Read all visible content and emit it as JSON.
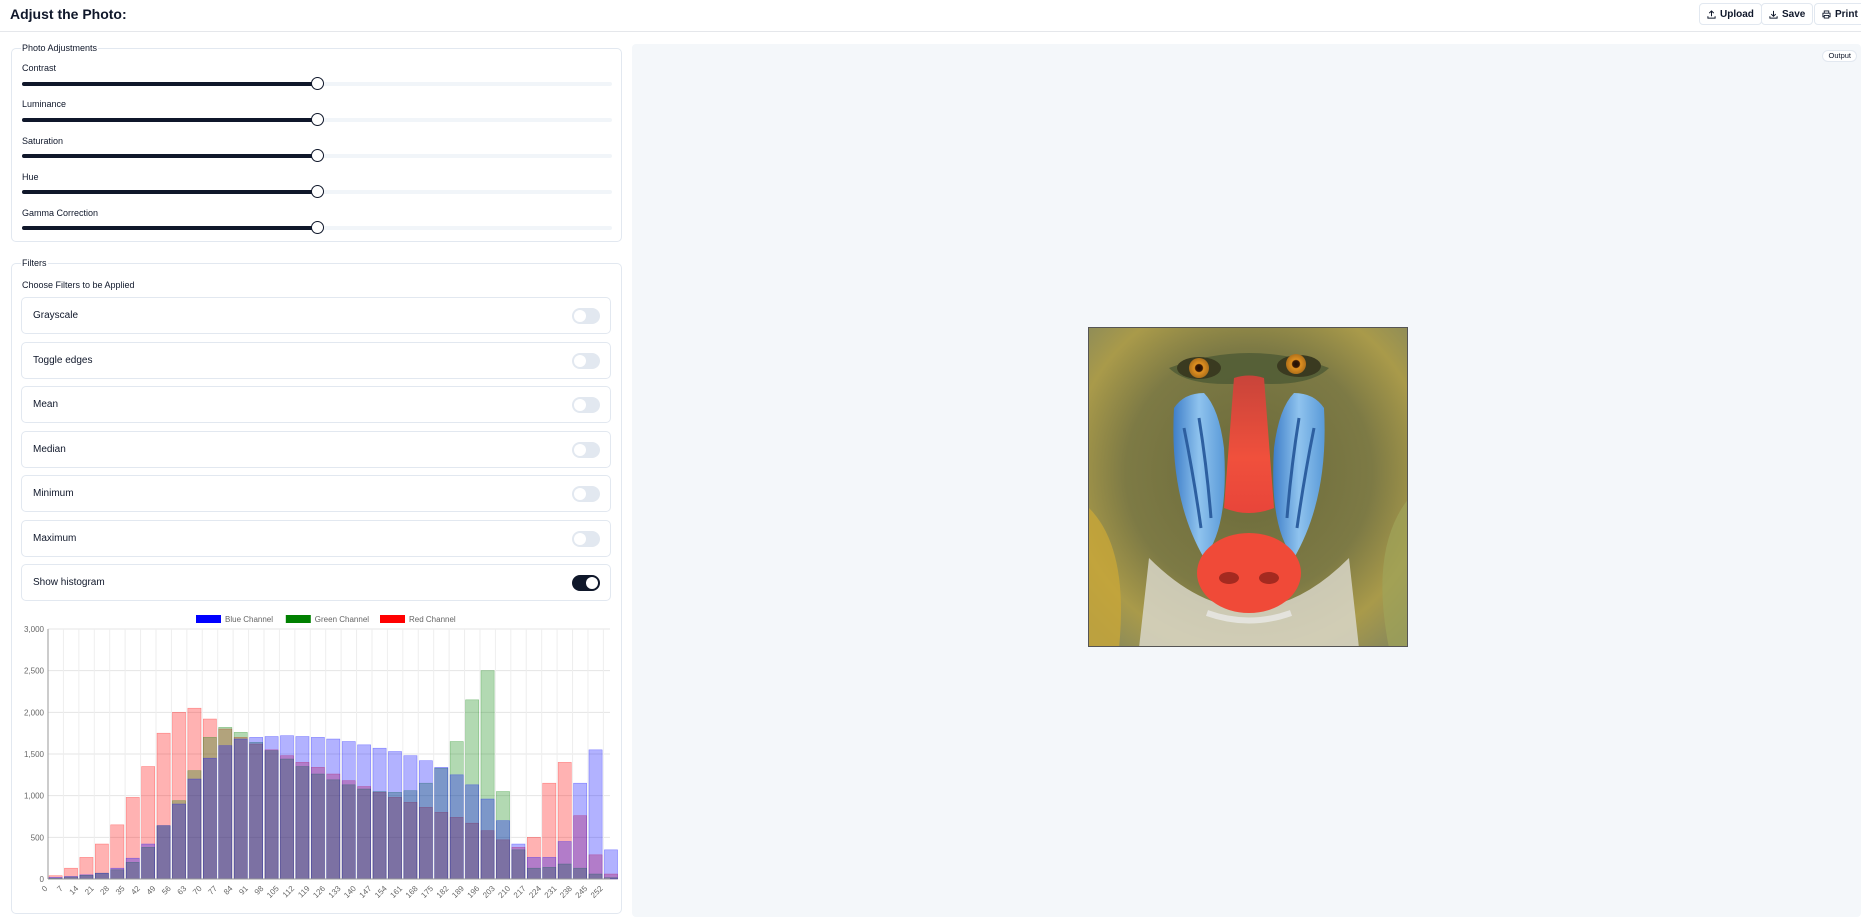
{
  "header": {
    "title": "Adjust the Photo:",
    "buttons": [
      {
        "label": "Upload",
        "icon": "upload-icon"
      },
      {
        "label": "Save",
        "icon": "download-icon"
      },
      {
        "label": "Print",
        "icon": "printer-icon"
      }
    ]
  },
  "adjustments": {
    "legend": "Photo Adjustments",
    "sliders": [
      {
        "label": "Contrast",
        "value": 0.5
      },
      {
        "label": "Luminance",
        "value": 0.5
      },
      {
        "label": "Saturation",
        "value": 0.5
      },
      {
        "label": "Hue",
        "value": 0.5
      },
      {
        "label": "Gamma Correction",
        "value": 0.5
      }
    ]
  },
  "filters": {
    "legend": "Filters",
    "subtitle": "Choose Filters to be Applied",
    "items": [
      {
        "label": "Grayscale",
        "on": false
      },
      {
        "label": "Toggle edges",
        "on": false
      },
      {
        "label": "Mean",
        "on": false
      },
      {
        "label": "Median",
        "on": false
      },
      {
        "label": "Minimum",
        "on": false
      },
      {
        "label": "Maximum",
        "on": false
      },
      {
        "label": "Show histogram",
        "on": true
      }
    ]
  },
  "output": {
    "badge": "Output"
  },
  "colors": {
    "accent": "#0f172a",
    "blue": "#0000ff",
    "green": "#008000",
    "red": "#ff0000",
    "output_bg": "#f4f7fa"
  },
  "chart_data": {
    "type": "bar",
    "legend_position": "top",
    "grid": true,
    "x": [
      0,
      7,
      14,
      21,
      28,
      35,
      42,
      49,
      56,
      63,
      70,
      77,
      84,
      91,
      98,
      105,
      112,
      119,
      126,
      133,
      140,
      147,
      154,
      161,
      168,
      175,
      182,
      189,
      196,
      203,
      210,
      217,
      224,
      231,
      238,
      245,
      252
    ],
    "xticks": [
      "0",
      "7",
      "14",
      "21",
      "28",
      "35",
      "42",
      "49",
      "56",
      "63",
      "70",
      "77",
      "84",
      "91",
      "98",
      "105",
      "112",
      "119",
      "126",
      "133",
      "140",
      "147",
      "154",
      "161",
      "168",
      "175",
      "182",
      "189",
      "196",
      "203",
      "210",
      "217",
      "224",
      "231",
      "238",
      "245",
      "252"
    ],
    "yticks": [
      "0",
      "500",
      "1,000",
      "1,500",
      "2,000",
      "2,500",
      "3,000"
    ],
    "ylim": [
      0,
      3000
    ],
    "series": [
      {
        "name": "Blue Channel",
        "color": "#0000ff",
        "values": [
          20,
          30,
          50,
          70,
          130,
          250,
          420,
          640,
          900,
          1200,
          1450,
          1600,
          1680,
          1700,
          1710,
          1720,
          1710,
          1700,
          1680,
          1650,
          1610,
          1570,
          1530,
          1480,
          1420,
          1340,
          1250,
          1130,
          960,
          700,
          420,
          260,
          260,
          450,
          1150,
          1550,
          350
        ]
      },
      {
        "name": "Green Channel",
        "color": "#008000",
        "values": [
          10,
          25,
          45,
          70,
          110,
          200,
          380,
          640,
          940,
          1300,
          1700,
          1820,
          1760,
          1640,
          1540,
          1440,
          1350,
          1260,
          1190,
          1130,
          1080,
          1050,
          1040,
          1060,
          1150,
          1330,
          1650,
          2150,
          2500,
          1050,
          350,
          130,
          140,
          180,
          130,
          60,
          15
        ]
      },
      {
        "name": "Red Channel",
        "color": "#ff0000",
        "values": [
          40,
          130,
          260,
          420,
          650,
          980,
          1350,
          1750,
          2000,
          2050,
          1920,
          1800,
          1700,
          1620,
          1550,
          1480,
          1400,
          1340,
          1260,
          1180,
          1110,
          1040,
          980,
          920,
          860,
          800,
          740,
          670,
          580,
          470,
          380,
          500,
          1150,
          1400,
          760,
          290,
          60
        ]
      }
    ]
  }
}
